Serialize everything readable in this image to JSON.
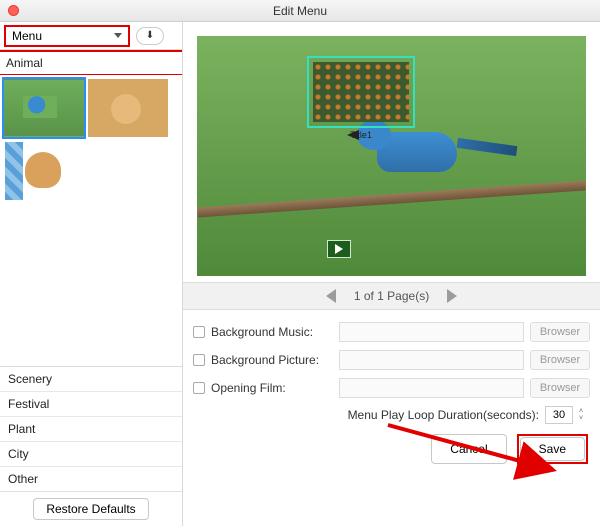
{
  "window": {
    "title": "Edit Menu"
  },
  "sidebar": {
    "dropdown_label": "Menu",
    "active_category": "Animal",
    "categories": [
      "Scenery",
      "Festival",
      "Plant",
      "City",
      "Other"
    ],
    "restore_label": "Restore Defaults"
  },
  "preview": {
    "title_label": "Title1"
  },
  "pager": {
    "text": "1 of 1 Page(s)"
  },
  "form": {
    "bg_music_label": "Background Music:",
    "bg_picture_label": "Background Picture:",
    "opening_film_label": "Opening Film:",
    "browser_label": "Browser",
    "loop_label": "Menu Play Loop Duration(seconds):",
    "loop_value": "30"
  },
  "footer": {
    "cancel_label": "Cancel",
    "save_label": "Save"
  }
}
